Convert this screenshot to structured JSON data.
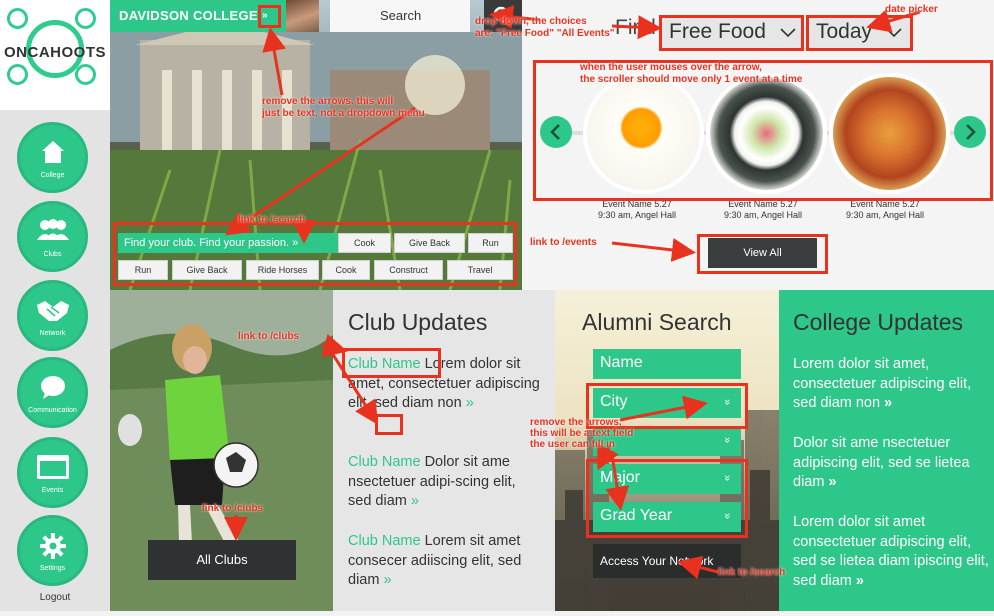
{
  "sidebar": {
    "logo": "ONCAHOOTS",
    "items": [
      {
        "label": "College",
        "icon": "home-icon"
      },
      {
        "label": "Clubs",
        "icon": "people-icon"
      },
      {
        "label": "Network",
        "icon": "handshake-icon"
      },
      {
        "label": "Communication",
        "icon": "chat-bubble-icon"
      },
      {
        "label": "Events",
        "icon": "calendar-window-icon"
      },
      {
        "label": "Settings",
        "icon": "gear-icon"
      }
    ],
    "logout": "Logout"
  },
  "header": {
    "college": "DAVIDSON COLLEGE",
    "college_arrow": "»",
    "search_label": "Search"
  },
  "hero": {
    "find_text": "Find your club. Find your passion. »",
    "tags_row1": [
      "Cook",
      "Give Back",
      "Run"
    ],
    "tags_row2": [
      "Run",
      "Give Back",
      "Ride Horses",
      "Cook",
      "Construct",
      "Travel"
    ]
  },
  "events": {
    "filter_prefix": "Find",
    "filter_selected": "Free Food",
    "date_selected": "Today",
    "caption_line1": "Event Name 5.27",
    "caption_line2": "9:30 am, Angel Hall",
    "prev": "‹",
    "next": "›",
    "view_all": "View All"
  },
  "clubs_block": {
    "all_clubs": "All Clubs"
  },
  "club_updates": {
    "title": "Club Updates",
    "items": [
      {
        "name": "Club Name",
        "text": "Lorem dolor sit amet, consectetuer adipiscing elit, sed diam non",
        "more": "»"
      },
      {
        "name": "Club Name",
        "text": "Dolor sit ame nsectetuer adipi-scing elit, sed diam",
        "more": "»"
      },
      {
        "name": "Club Name",
        "text": "Lorem sit amet consecer adiiscing elit, sed diam",
        "more": "»"
      }
    ]
  },
  "alumni": {
    "title": "Alumni Search",
    "fields": [
      "Name",
      "City",
      "",
      "Major",
      "Grad Year"
    ],
    "arrow": "»",
    "access": "Access Your Network"
  },
  "college_updates": {
    "title": "College Updates",
    "items": [
      "Lorem dolor sit amet, consectetuer adipiscing elit, sed diam non",
      "Dolor sit ame nsectetuer adipiscing elit, sed se lietea diam",
      "Lorem dolor sit amet consectetuer adipiscing elit, sed se lietea diam ipiscing elit, sed diam"
    ],
    "more": "»"
  },
  "annotations": {
    "dropdown": "drop down, the choices\nare: \"Free Food\" \"All Events\"",
    "date_picker": "date picker",
    "remove_arrows": "remove the arrows. this will\njust be text, not a dropdown menu",
    "scroller": "when the user mouses over the arrow,\nthe scroller should move only 1 event at a time",
    "link_search": "link to /search",
    "link_events": "link to /events",
    "link_clubs_1": "link  to /clubs",
    "link_clubs_2": "link to /clubs",
    "remove_arrows_text": "remove the arrows,\nthis will be a text field\nthe user can fill in",
    "link_search_2": "link to /search"
  },
  "colors": {
    "accent": "#2ec78a",
    "annotation": "#e8321e",
    "dark_button": "#3a3d3e"
  }
}
